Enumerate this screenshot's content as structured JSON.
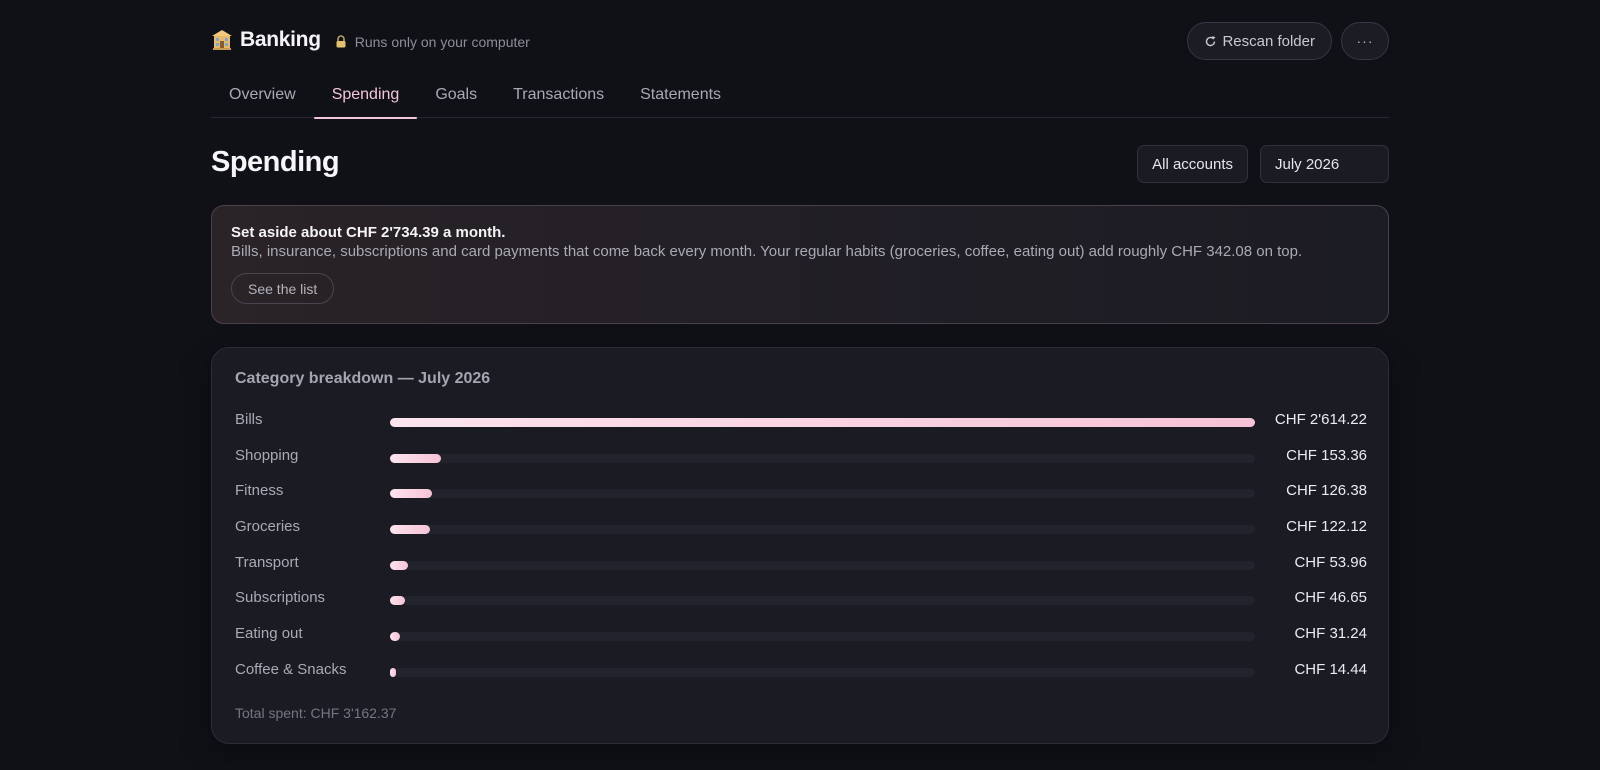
{
  "header": {
    "app_title": "Banking",
    "local_note": "Runs only on your computer",
    "rescan_label": "Rescan folder",
    "more_label": "···"
  },
  "tabs": [
    {
      "label": "Overview",
      "active": false
    },
    {
      "label": "Spending",
      "active": true
    },
    {
      "label": "Goals",
      "active": false
    },
    {
      "label": "Transactions",
      "active": false
    },
    {
      "label": "Statements",
      "active": false
    }
  ],
  "page": {
    "title": "Spending",
    "account_filter": "All accounts",
    "month_filter": "July 2026"
  },
  "callout": {
    "title": "Set aside about CHF 2'734.39 a month.",
    "text": "Bills, insurance, subscriptions and card payments that come back every month. Your regular habits (groceries, coffee, eating out) add roughly CHF 342.08 on top.",
    "button_label": "See the list"
  },
  "breakdown": {
    "title": "Category breakdown — July 2026",
    "total_label": "Total spent: CHF 3'162.37",
    "max_value": 2614.22,
    "categories": [
      {
        "label": "Bills",
        "value": 2614.22,
        "value_label": "CHF 2'614.22"
      },
      {
        "label": "Shopping",
        "value": 153.36,
        "value_label": "CHF 153.36"
      },
      {
        "label": "Fitness",
        "value": 126.38,
        "value_label": "CHF 126.38"
      },
      {
        "label": "Groceries",
        "value": 122.12,
        "value_label": "CHF 122.12"
      },
      {
        "label": "Transport",
        "value": 53.96,
        "value_label": "CHF 53.96"
      },
      {
        "label": "Subscriptions",
        "value": 46.65,
        "value_label": "CHF 46.65"
      },
      {
        "label": "Eating out",
        "value": 31.24,
        "value_label": "CHF 31.24"
      },
      {
        "label": "Coffee & Snacks",
        "value": 14.44,
        "value_label": "CHF 14.44"
      }
    ]
  },
  "colors": {
    "background": "#101117",
    "accent": "#f2c6d8",
    "card": "#1a1b23"
  },
  "icons": {
    "brand": "bank-building-icon",
    "lock": "lock-icon",
    "refresh": "refresh-icon"
  }
}
